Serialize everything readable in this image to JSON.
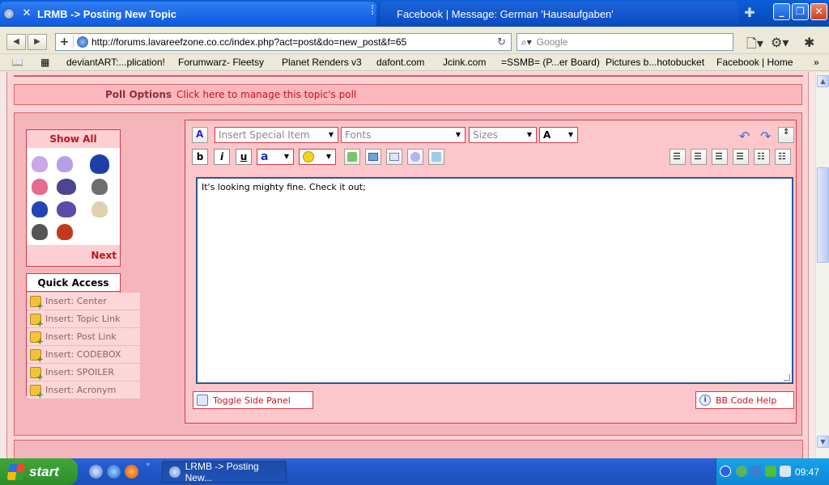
{
  "browser": {
    "active_tab_title": "LRMB -> Posting New Topic",
    "inactive_tab_title": "Facebook | Message: German 'Hausaufgaben'",
    "url": "http://forums.lavareefzone.co.cc/index.php?act=post&do=new_post&f=65",
    "search_placeholder": "Google",
    "bookmarks": [
      "deviantART:...plication!",
      "Forumwarz- Fleetsy",
      "Planet Renders v3",
      "dafont.com",
      "Jcink.com",
      "=SSMB= (P...er Board)",
      "Pictures b...hotobucket",
      "Facebook | Home"
    ]
  },
  "forum": {
    "poll_label": "Poll Options",
    "poll_link": "Click here to manage this topic's poll",
    "emoticons": {
      "show_all": "Show All",
      "next": "Next"
    },
    "quick_access": {
      "title": "Quick Access",
      "items": [
        "Insert: Center",
        "Insert: Topic Link",
        "Insert: Post Link",
        "Insert: CODEBOX",
        "Insert: SPOILER",
        "Insert: Acronym"
      ]
    },
    "editor": {
      "special_item": "Insert Special Item",
      "fonts": "Fonts",
      "sizes": "Sizes",
      "color_label": "A",
      "bold": "b",
      "italic": "i",
      "underline": "u",
      "font_color": "a",
      "body": "It's looking mighty fine. Check it out;",
      "toggle_side_panel": "Toggle Side Panel",
      "bb_code_help": "BB Code Help"
    }
  },
  "taskbar": {
    "start": "start",
    "task_item": "LRMB -> Posting New...",
    "clock": "09:47"
  },
  "colors": {
    "accent": "#c2121d",
    "panel": "#f5b6bb",
    "xp_blue": "#2057c9"
  }
}
